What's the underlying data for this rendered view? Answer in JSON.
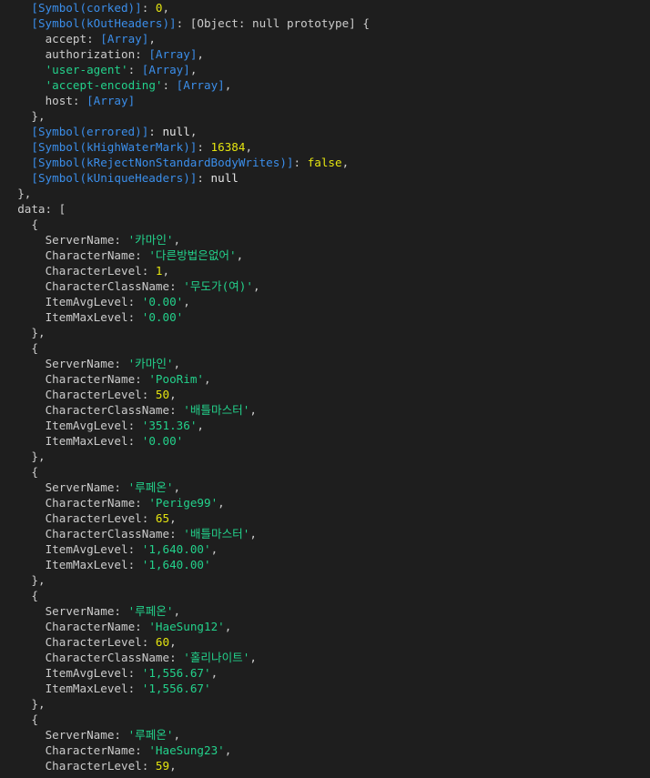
{
  "colors": {
    "background": "#1e1e1e",
    "plain": "#cccccc",
    "symbol": "#3b8eea",
    "string": "#23d18b",
    "number": "#e5e510",
    "null": "#e5e5e5"
  },
  "lines": [
    {
      "indent": 4,
      "tokens": [
        {
          "t": "[Symbol(corked)]",
          "c": "symbol"
        },
        {
          "t": ": ",
          "c": "plain"
        },
        {
          "t": "0",
          "c": "number"
        },
        {
          "t": ",",
          "c": "plain"
        }
      ]
    },
    {
      "indent": 4,
      "tokens": [
        {
          "t": "[Symbol(kOutHeaders)]",
          "c": "symbol"
        },
        {
          "t": ": [Object: null prototype] {",
          "c": "plain"
        }
      ]
    },
    {
      "indent": 6,
      "tokens": [
        {
          "t": "accept: ",
          "c": "plain"
        },
        {
          "t": "[Array]",
          "c": "array"
        },
        {
          "t": ",",
          "c": "plain"
        }
      ]
    },
    {
      "indent": 6,
      "tokens": [
        {
          "t": "authorization: ",
          "c": "plain"
        },
        {
          "t": "[Array]",
          "c": "array"
        },
        {
          "t": ",",
          "c": "plain"
        }
      ]
    },
    {
      "indent": 6,
      "tokens": [
        {
          "t": "'user-agent'",
          "c": "string"
        },
        {
          "t": ": ",
          "c": "plain"
        },
        {
          "t": "[Array]",
          "c": "array"
        },
        {
          "t": ",",
          "c": "plain"
        }
      ]
    },
    {
      "indent": 6,
      "tokens": [
        {
          "t": "'accept-encoding'",
          "c": "string"
        },
        {
          "t": ": ",
          "c": "plain"
        },
        {
          "t": "[Array]",
          "c": "array"
        },
        {
          "t": ",",
          "c": "plain"
        }
      ]
    },
    {
      "indent": 6,
      "tokens": [
        {
          "t": "host: ",
          "c": "plain"
        },
        {
          "t": "[Array]",
          "c": "array"
        }
      ]
    },
    {
      "indent": 4,
      "tokens": [
        {
          "t": "},",
          "c": "plain"
        }
      ]
    },
    {
      "indent": 4,
      "tokens": [
        {
          "t": "[Symbol(errored)]",
          "c": "symbol"
        },
        {
          "t": ": ",
          "c": "plain"
        },
        {
          "t": "null",
          "c": "null"
        },
        {
          "t": ",",
          "c": "plain"
        }
      ]
    },
    {
      "indent": 4,
      "tokens": [
        {
          "t": "[Symbol(kHighWaterMark)]",
          "c": "symbol"
        },
        {
          "t": ": ",
          "c": "plain"
        },
        {
          "t": "16384",
          "c": "number"
        },
        {
          "t": ",",
          "c": "plain"
        }
      ]
    },
    {
      "indent": 4,
      "tokens": [
        {
          "t": "[Symbol(kRejectNonStandardBodyWrites)]",
          "c": "symbol"
        },
        {
          "t": ": ",
          "c": "plain"
        },
        {
          "t": "false",
          "c": "bool"
        },
        {
          "t": ",",
          "c": "plain"
        }
      ]
    },
    {
      "indent": 4,
      "tokens": [
        {
          "t": "[Symbol(kUniqueHeaders)]",
          "c": "symbol"
        },
        {
          "t": ": ",
          "c": "plain"
        },
        {
          "t": "null",
          "c": "null"
        }
      ]
    },
    {
      "indent": 2,
      "tokens": [
        {
          "t": "},",
          "c": "plain"
        }
      ]
    },
    {
      "indent": 2,
      "tokens": [
        {
          "t": "data: [",
          "c": "plain"
        }
      ]
    },
    {
      "indent": 4,
      "tokens": [
        {
          "t": "{",
          "c": "plain"
        }
      ]
    },
    {
      "indent": 6,
      "tokens": [
        {
          "t": "ServerName: ",
          "c": "plain"
        },
        {
          "t": "'카마인'",
          "c": "string"
        },
        {
          "t": ",",
          "c": "plain"
        }
      ]
    },
    {
      "indent": 6,
      "tokens": [
        {
          "t": "CharacterName: ",
          "c": "plain"
        },
        {
          "t": "'다른방법은없어'",
          "c": "string"
        },
        {
          "t": ",",
          "c": "plain"
        }
      ]
    },
    {
      "indent": 6,
      "tokens": [
        {
          "t": "CharacterLevel: ",
          "c": "plain"
        },
        {
          "t": "1",
          "c": "number"
        },
        {
          "t": ",",
          "c": "plain"
        }
      ]
    },
    {
      "indent": 6,
      "tokens": [
        {
          "t": "CharacterClassName: ",
          "c": "plain"
        },
        {
          "t": "'무도가(여)'",
          "c": "string"
        },
        {
          "t": ",",
          "c": "plain"
        }
      ]
    },
    {
      "indent": 6,
      "tokens": [
        {
          "t": "ItemAvgLevel: ",
          "c": "plain"
        },
        {
          "t": "'0.00'",
          "c": "string"
        },
        {
          "t": ",",
          "c": "plain"
        }
      ]
    },
    {
      "indent": 6,
      "tokens": [
        {
          "t": "ItemMaxLevel: ",
          "c": "plain"
        },
        {
          "t": "'0.00'",
          "c": "string"
        }
      ]
    },
    {
      "indent": 4,
      "tokens": [
        {
          "t": "},",
          "c": "plain"
        }
      ]
    },
    {
      "indent": 4,
      "tokens": [
        {
          "t": "{",
          "c": "plain"
        }
      ]
    },
    {
      "indent": 6,
      "tokens": [
        {
          "t": "ServerName: ",
          "c": "plain"
        },
        {
          "t": "'카마인'",
          "c": "string"
        },
        {
          "t": ",",
          "c": "plain"
        }
      ]
    },
    {
      "indent": 6,
      "tokens": [
        {
          "t": "CharacterName: ",
          "c": "plain"
        },
        {
          "t": "'PooRim'",
          "c": "string"
        },
        {
          "t": ",",
          "c": "plain"
        }
      ]
    },
    {
      "indent": 6,
      "tokens": [
        {
          "t": "CharacterLevel: ",
          "c": "plain"
        },
        {
          "t": "50",
          "c": "number"
        },
        {
          "t": ",",
          "c": "plain"
        }
      ]
    },
    {
      "indent": 6,
      "tokens": [
        {
          "t": "CharacterClassName: ",
          "c": "plain"
        },
        {
          "t": "'배틀마스터'",
          "c": "string"
        },
        {
          "t": ",",
          "c": "plain"
        }
      ]
    },
    {
      "indent": 6,
      "tokens": [
        {
          "t": "ItemAvgLevel: ",
          "c": "plain"
        },
        {
          "t": "'351.36'",
          "c": "string"
        },
        {
          "t": ",",
          "c": "plain"
        }
      ]
    },
    {
      "indent": 6,
      "tokens": [
        {
          "t": "ItemMaxLevel: ",
          "c": "plain"
        },
        {
          "t": "'0.00'",
          "c": "string"
        }
      ]
    },
    {
      "indent": 4,
      "tokens": [
        {
          "t": "},",
          "c": "plain"
        }
      ]
    },
    {
      "indent": 4,
      "tokens": [
        {
          "t": "{",
          "c": "plain"
        }
      ]
    },
    {
      "indent": 6,
      "tokens": [
        {
          "t": "ServerName: ",
          "c": "plain"
        },
        {
          "t": "'루페온'",
          "c": "string"
        },
        {
          "t": ",",
          "c": "plain"
        }
      ]
    },
    {
      "indent": 6,
      "tokens": [
        {
          "t": "CharacterName: ",
          "c": "plain"
        },
        {
          "t": "'Perige99'",
          "c": "string"
        },
        {
          "t": ",",
          "c": "plain"
        }
      ]
    },
    {
      "indent": 6,
      "tokens": [
        {
          "t": "CharacterLevel: ",
          "c": "plain"
        },
        {
          "t": "65",
          "c": "number"
        },
        {
          "t": ",",
          "c": "plain"
        }
      ]
    },
    {
      "indent": 6,
      "tokens": [
        {
          "t": "CharacterClassName: ",
          "c": "plain"
        },
        {
          "t": "'배틀마스터'",
          "c": "string"
        },
        {
          "t": ",",
          "c": "plain"
        }
      ]
    },
    {
      "indent": 6,
      "tokens": [
        {
          "t": "ItemAvgLevel: ",
          "c": "plain"
        },
        {
          "t": "'1,640.00'",
          "c": "string"
        },
        {
          "t": ",",
          "c": "plain"
        }
      ]
    },
    {
      "indent": 6,
      "tokens": [
        {
          "t": "ItemMaxLevel: ",
          "c": "plain"
        },
        {
          "t": "'1,640.00'",
          "c": "string"
        }
      ]
    },
    {
      "indent": 4,
      "tokens": [
        {
          "t": "},",
          "c": "plain"
        }
      ]
    },
    {
      "indent": 4,
      "tokens": [
        {
          "t": "{",
          "c": "plain"
        }
      ]
    },
    {
      "indent": 6,
      "tokens": [
        {
          "t": "ServerName: ",
          "c": "plain"
        },
        {
          "t": "'루페온'",
          "c": "string"
        },
        {
          "t": ",",
          "c": "plain"
        }
      ]
    },
    {
      "indent": 6,
      "tokens": [
        {
          "t": "CharacterName: ",
          "c": "plain"
        },
        {
          "t": "'HaeSung12'",
          "c": "string"
        },
        {
          "t": ",",
          "c": "plain"
        }
      ]
    },
    {
      "indent": 6,
      "tokens": [
        {
          "t": "CharacterLevel: ",
          "c": "plain"
        },
        {
          "t": "60",
          "c": "number"
        },
        {
          "t": ",",
          "c": "plain"
        }
      ]
    },
    {
      "indent": 6,
      "tokens": [
        {
          "t": "CharacterClassName: ",
          "c": "plain"
        },
        {
          "t": "'홀리나이트'",
          "c": "string"
        },
        {
          "t": ",",
          "c": "plain"
        }
      ]
    },
    {
      "indent": 6,
      "tokens": [
        {
          "t": "ItemAvgLevel: ",
          "c": "plain"
        },
        {
          "t": "'1,556.67'",
          "c": "string"
        },
        {
          "t": ",",
          "c": "plain"
        }
      ]
    },
    {
      "indent": 6,
      "tokens": [
        {
          "t": "ItemMaxLevel: ",
          "c": "plain"
        },
        {
          "t": "'1,556.67'",
          "c": "string"
        }
      ]
    },
    {
      "indent": 4,
      "tokens": [
        {
          "t": "},",
          "c": "plain"
        }
      ]
    },
    {
      "indent": 4,
      "tokens": [
        {
          "t": "{",
          "c": "plain"
        }
      ]
    },
    {
      "indent": 6,
      "tokens": [
        {
          "t": "ServerName: ",
          "c": "plain"
        },
        {
          "t": "'루페온'",
          "c": "string"
        },
        {
          "t": ",",
          "c": "plain"
        }
      ]
    },
    {
      "indent": 6,
      "tokens": [
        {
          "t": "CharacterName: ",
          "c": "plain"
        },
        {
          "t": "'HaeSung23'",
          "c": "string"
        },
        {
          "t": ",",
          "c": "plain"
        }
      ]
    },
    {
      "indent": 6,
      "tokens": [
        {
          "t": "CharacterLevel: ",
          "c": "plain"
        },
        {
          "t": "59",
          "c": "number"
        },
        {
          "t": ",",
          "c": "plain"
        }
      ]
    }
  ]
}
